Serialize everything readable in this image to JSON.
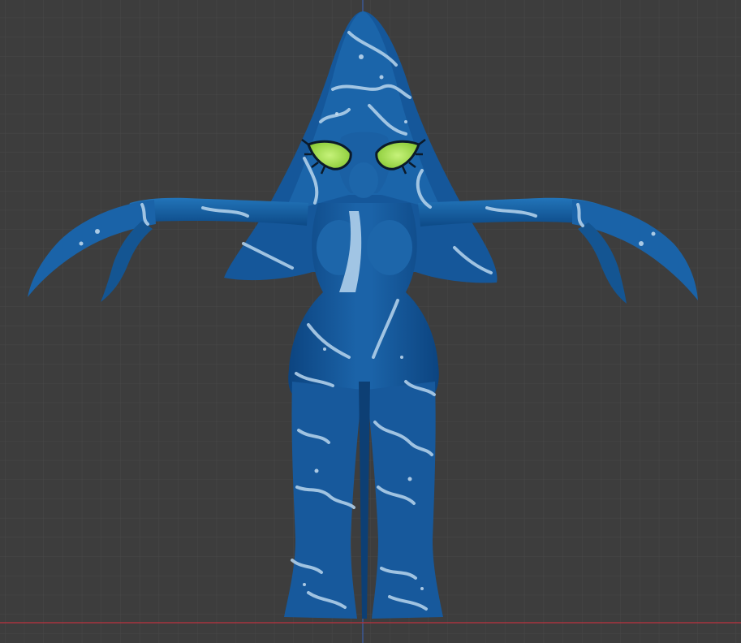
{
  "viewport": {
    "view": "front-orthographic",
    "colors": {
      "background": "#3d3d3d",
      "grid_minor": "#4a4a4a",
      "grid_major": "#565656",
      "axis_x": "#b23a43",
      "axis_z": "#3c5fa8"
    }
  },
  "model": {
    "description_icon": "character-model-icon",
    "colors": {
      "body_dark": "#0e4a86",
      "body_mid": "#1b62a6",
      "body_light": "#2a78bd",
      "vein": "#b9d6ee",
      "eye": "#9ee04a",
      "eye_outline": "#0b1a2a"
    }
  }
}
